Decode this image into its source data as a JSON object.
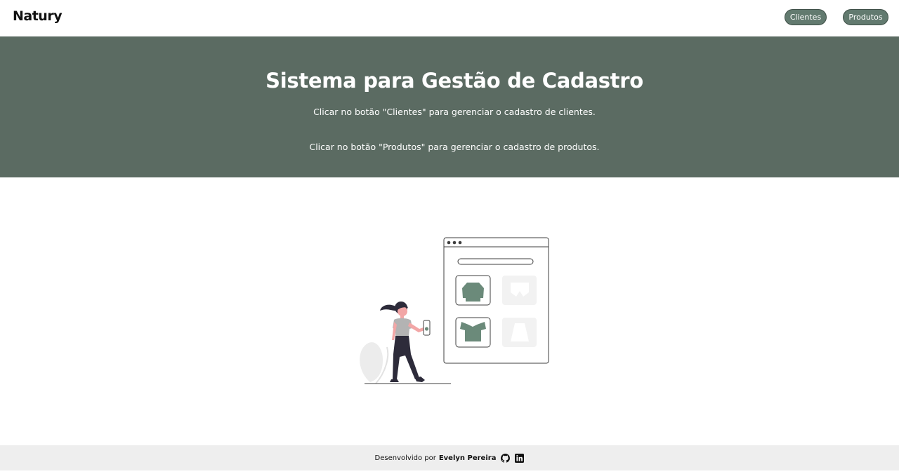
{
  "header": {
    "logo": "Natury",
    "nav": {
      "clientes": "Clientes",
      "produtos": "Produtos"
    }
  },
  "hero": {
    "title": "Sistema para Gestão de Cadastro",
    "line1": "Clicar no botão \"Clientes\" para gerenciar o cadastro de clientes.",
    "line2": "Clicar no botão \"Produtos\" para gerenciar o cadastro de produtos."
  },
  "illustration": {
    "icon": "online-shopping-illustration"
  },
  "footer": {
    "prefix": "Desenvolvido por",
    "author": "Evelyn Pereira",
    "icons": [
      "github-icon",
      "linkedin-icon"
    ]
  },
  "colors": {
    "hero_bg": "#5b6b62",
    "button_bg": "#627a6f",
    "accent": "#6b8a7a",
    "footer_bg": "#eeeeee"
  }
}
